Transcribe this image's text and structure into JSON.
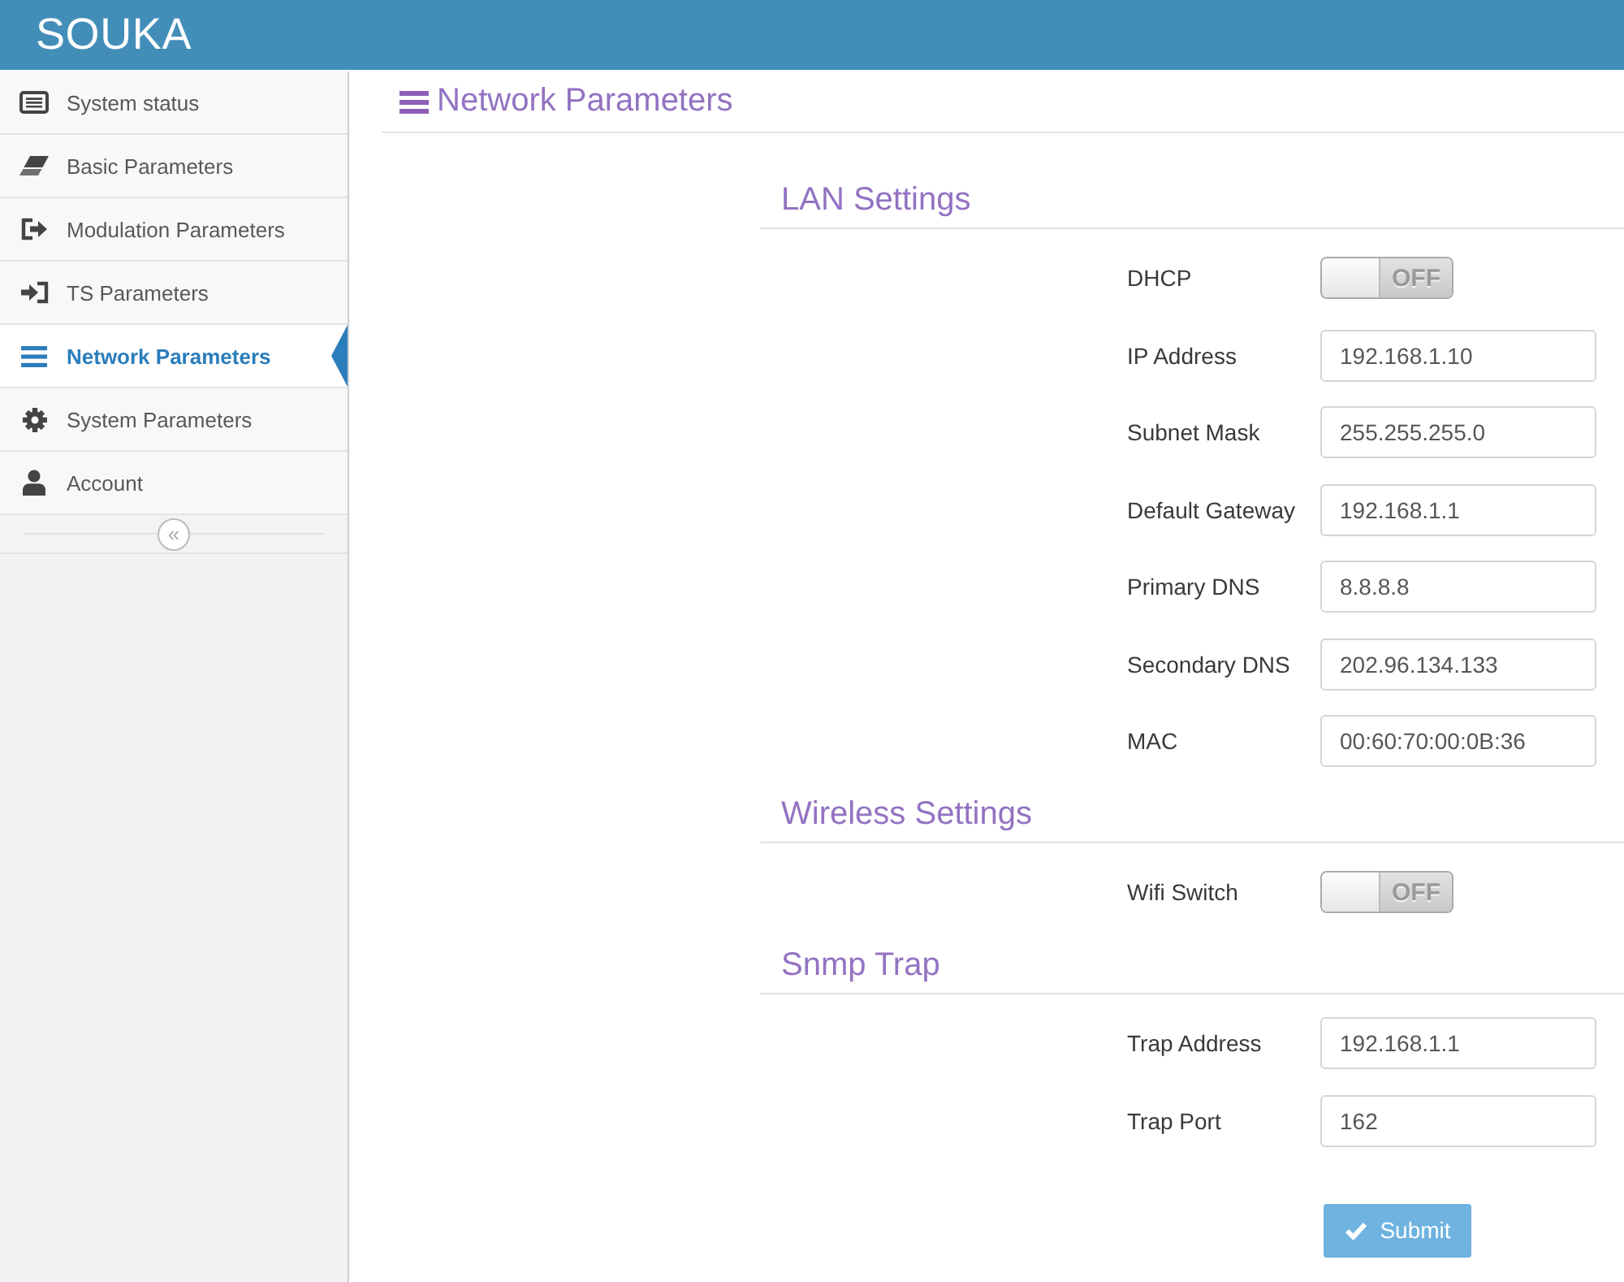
{
  "header": {
    "title": "SOUKA"
  },
  "sidebar": {
    "items": [
      {
        "label": "System status",
        "selected": false
      },
      {
        "label": "Basic Parameters",
        "selected": false
      },
      {
        "label": "Modulation Parameters",
        "selected": false
      },
      {
        "label": "TS Parameters",
        "selected": false
      },
      {
        "label": "Network Parameters",
        "selected": true
      },
      {
        "label": "System Parameters",
        "selected": false
      },
      {
        "label": "Account",
        "selected": false
      }
    ],
    "collapse_button": "«"
  },
  "page": {
    "title": "Network Parameters"
  },
  "sections": [
    {
      "title": "LAN Settings",
      "fields": [
        {
          "kind": "toggle",
          "label": "DHCP",
          "on": false,
          "state_text": "OFF"
        },
        {
          "kind": "input",
          "label": "IP Address",
          "value": "192.168.1.10"
        },
        {
          "kind": "input",
          "label": "Subnet Mask",
          "value": "255.255.255.0"
        },
        {
          "kind": "input",
          "label": "Default Gateway",
          "value": "192.168.1.1"
        },
        {
          "kind": "input",
          "label": "Primary DNS",
          "value": "8.8.8.8"
        },
        {
          "kind": "input",
          "label": "Secondary DNS",
          "value": "202.96.134.133"
        },
        {
          "kind": "input",
          "label": "MAC",
          "value": "00:60:70:00:0B:36"
        }
      ]
    },
    {
      "title": "Wireless Settings",
      "fields": [
        {
          "kind": "toggle",
          "label": "Wifi Switch",
          "on": false,
          "state_text": "OFF"
        }
      ]
    },
    {
      "title": "Snmp Trap",
      "fields": [
        {
          "kind": "input",
          "label": "Trap Address",
          "value": "192.168.1.1"
        },
        {
          "kind": "input",
          "label": "Trap Port",
          "value": "162"
        }
      ]
    }
  ],
  "submit_button": {
    "label": "Submit"
  }
}
